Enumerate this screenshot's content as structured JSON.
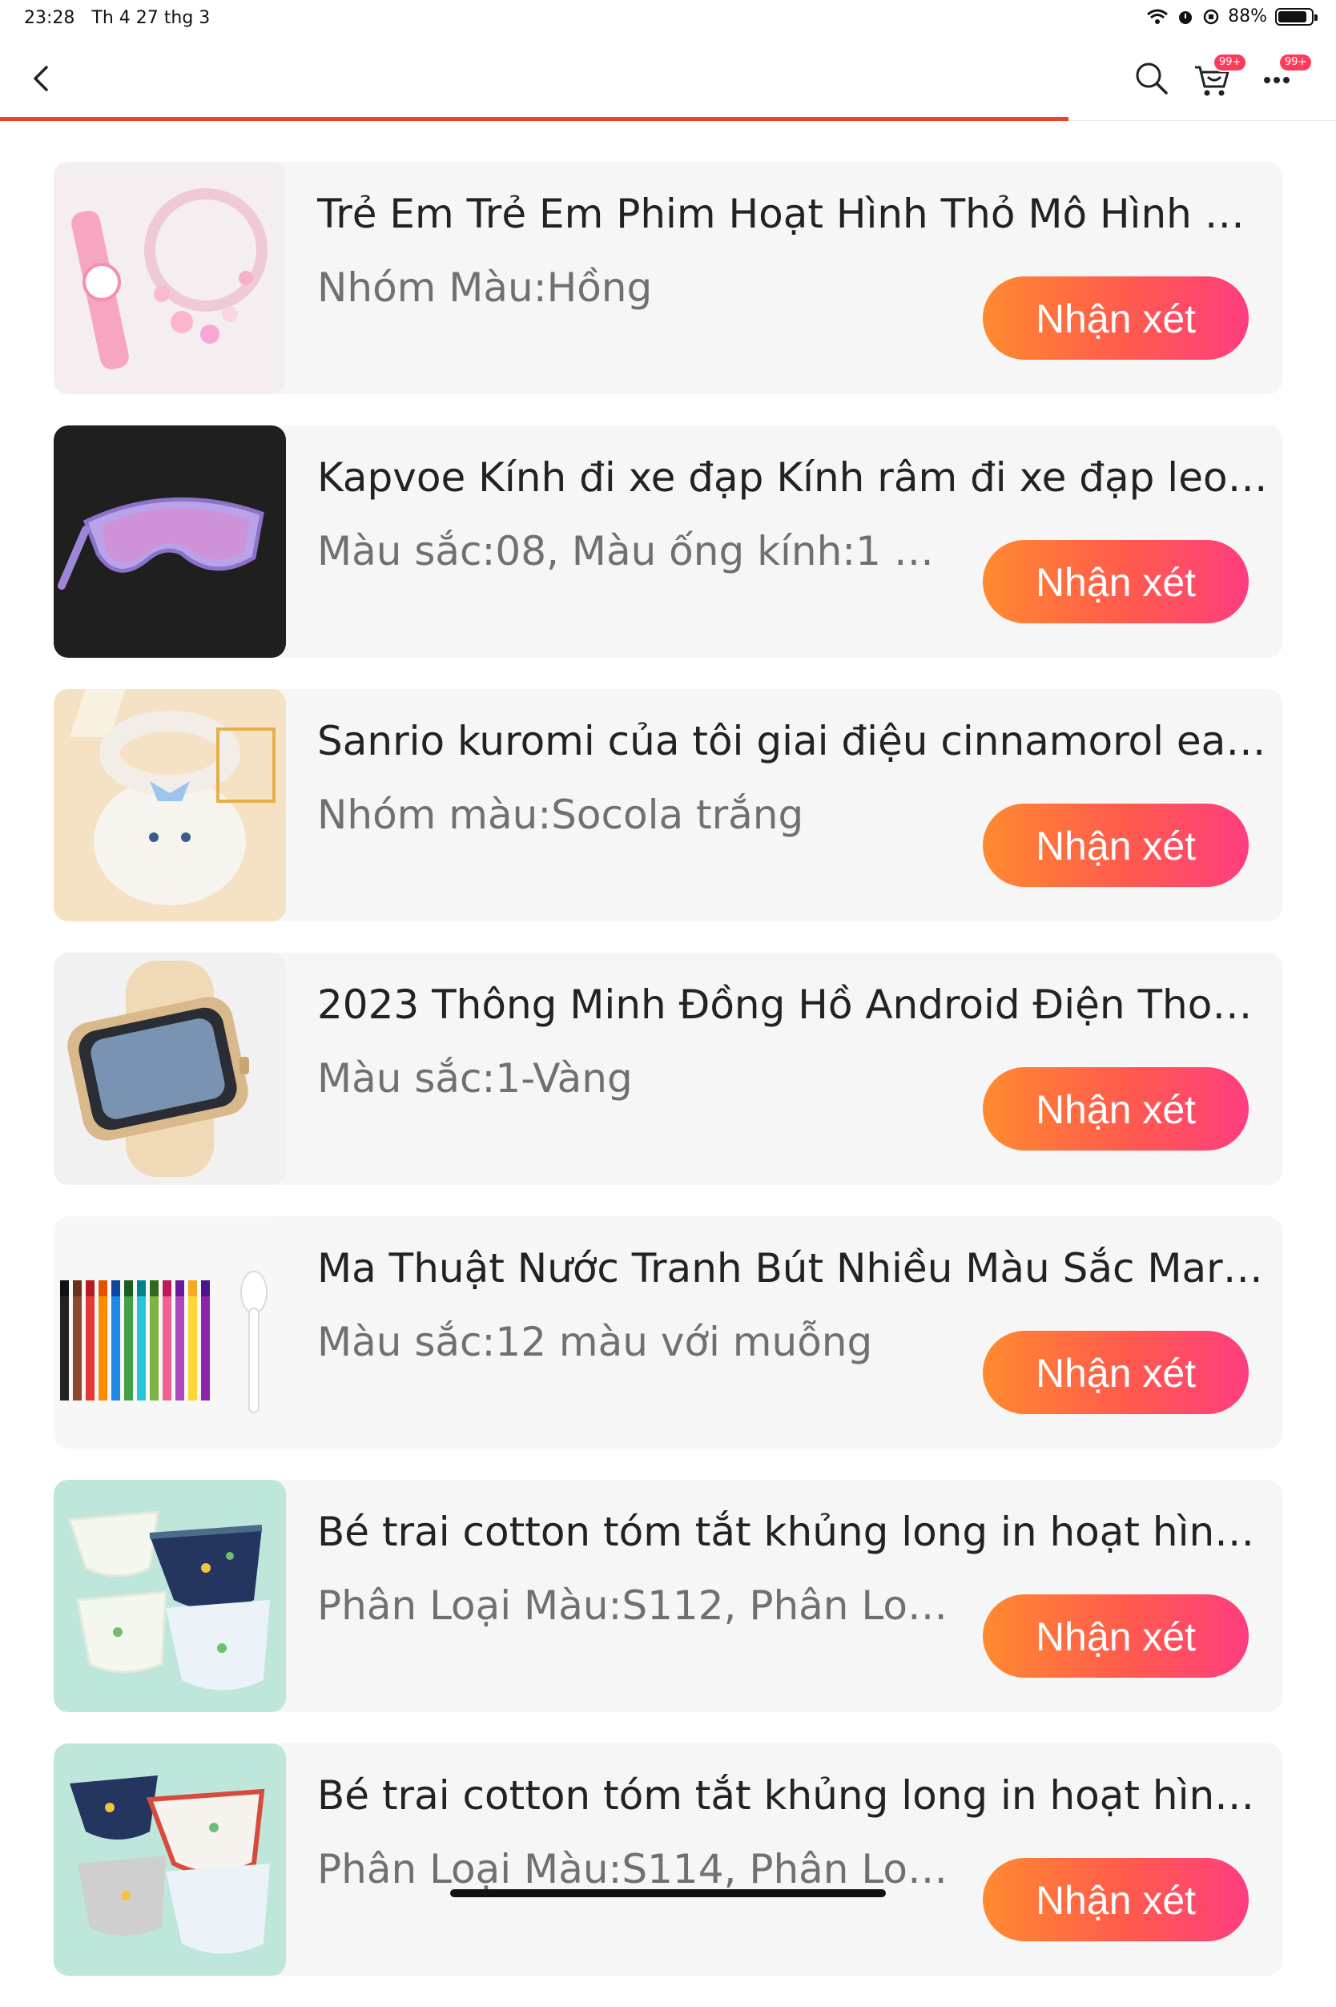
{
  "status_bar": {
    "time": "23:28",
    "date": "Th 4 27 thg 3",
    "battery": "88%",
    "battery_level": 0.88
  },
  "nav": {
    "back_icon": "chevron-left-icon",
    "search_icon": "search-icon",
    "cart_icon": "cart-icon",
    "cart_badge": "99+",
    "more_icon": "more-dots-icon",
    "more_badge": "99+"
  },
  "page_progress": 0.8,
  "colors": {
    "accent": "#e8442b",
    "button_start": "#ff8a2f",
    "button_end": "#ff3d7f",
    "badge": "#ff3b5c"
  },
  "items": [
    {
      "title": "Trẻ Em Trẻ Em Phim Hoạt Hình Thỏ Mô Hình Đồ...",
      "variant": "Nhóm Màu:Hồng",
      "button": "Nhận xét"
    },
    {
      "title": "Kapvoe Kính đi xe đạp Kính râm đi xe đạp leo n...",
      "variant": "Màu sắc:08, Màu ống kính:1 ốn...",
      "button": "Nhận xét"
    },
    {
      "title": "Sanrio kuromi của tôi giai điệu cinnamorol ear...",
      "variant": "Nhóm màu:Socola trắng",
      "button": "Nhận xét"
    },
    {
      "title": "2023 Thông Minh Đồng Hồ Android Điện Thoại ...",
      "variant": "Màu sắc:1-Vàng",
      "button": "Nhận xét"
    },
    {
      "title": "Ma Thuật Nước Tranh Bút Nhiều Màu Sắc Mark ...",
      "variant": "Màu sắc:12 màu với muỗng",
      "button": "Nhận xét"
    },
    {
      "title": "Bé trai cotton tóm tắt khủng long in hoạt hình ...",
      "variant": "Phân Loại Màu:S112, Phân Loại ...",
      "button": "Nhận xét"
    },
    {
      "title": "Bé trai cotton tóm tắt khủng long in hoạt hình ...",
      "variant": "Phân Loại Màu:S114, Phân Loại ...",
      "button": "Nhận xét"
    }
  ]
}
